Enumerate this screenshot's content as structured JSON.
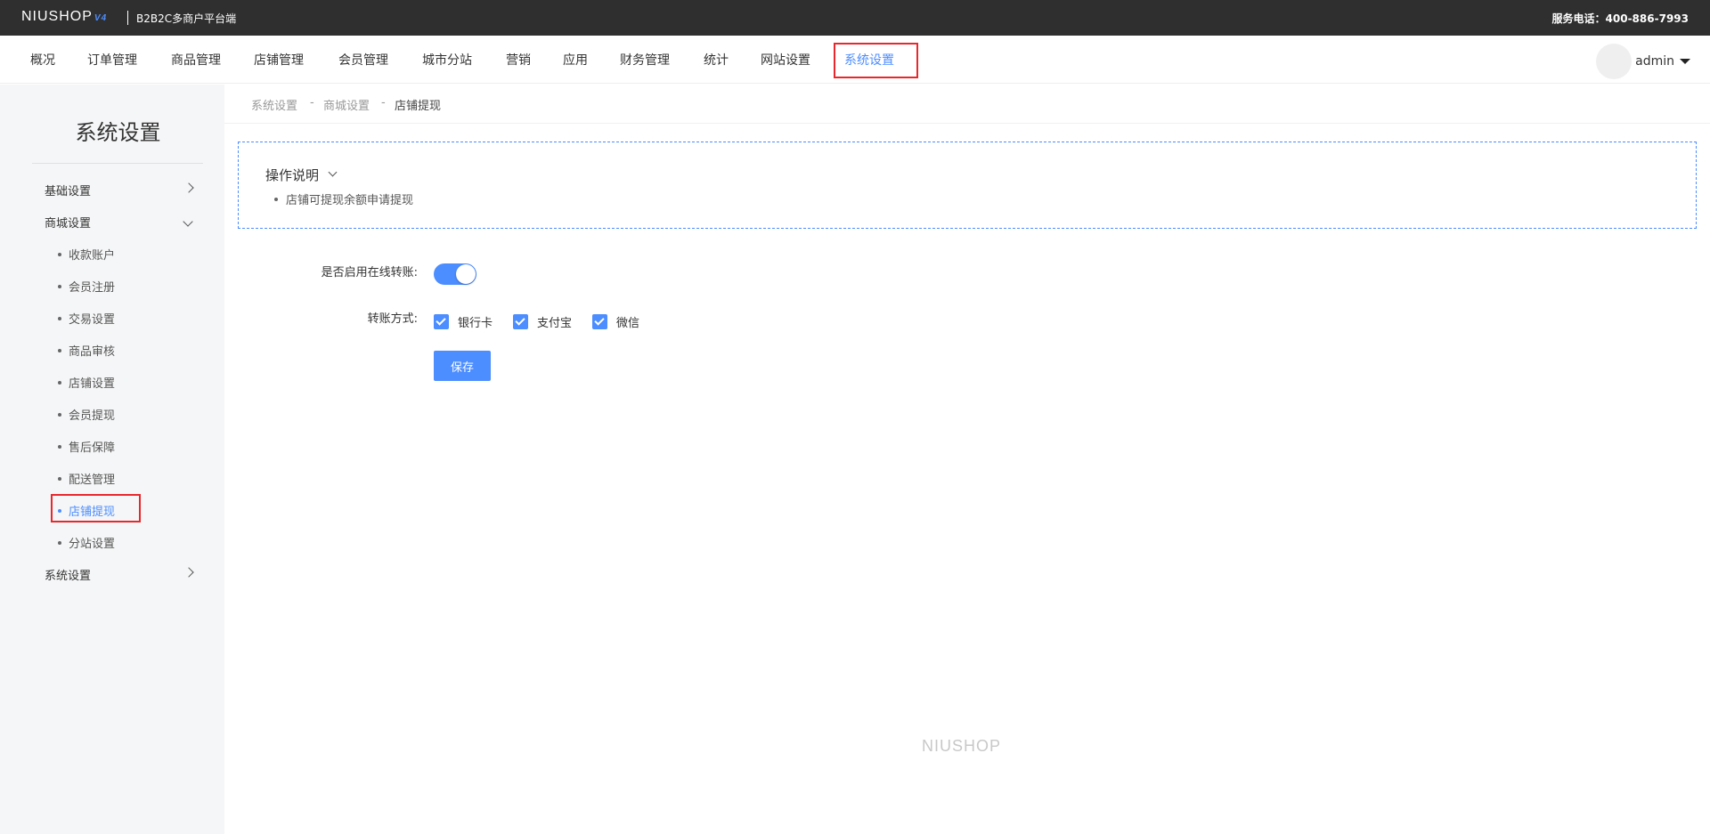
{
  "topbar": {
    "logo": "NIUSHOP",
    "logo_version": "V4",
    "platform": "B2B2C多商户平台端",
    "service_label": "服务电话：400-886-7993"
  },
  "nav": {
    "items": [
      "概况",
      "订单管理",
      "商品管理",
      "店铺管理",
      "会员管理",
      "城市分站",
      "营销",
      "应用",
      "财务管理",
      "统计",
      "网站设置",
      "系统设置"
    ],
    "active": "系统设置",
    "user": "admin"
  },
  "sidebar": {
    "title": "系统设置",
    "groups": [
      {
        "label": "基础设置"
      },
      {
        "label": "商城设置"
      },
      {
        "label": "系统设置"
      }
    ],
    "sub_items": [
      "收款账户",
      "会员注册",
      "交易设置",
      "商品审核",
      "店铺设置",
      "会员提现",
      "售后保障",
      "配送管理",
      "店铺提现",
      "分站设置"
    ],
    "active": "店铺提现"
  },
  "breadcrumb": {
    "items": [
      "系统设置",
      "商城设置",
      "店铺提现"
    ],
    "sep": "-"
  },
  "tip": {
    "title": "操作说明",
    "items": [
      "店铺可提现余额申请提现"
    ]
  },
  "form": {
    "online_transfer_label": "是否启用在线转账:",
    "online_transfer_enabled": true,
    "transfer_method_label": "转账方式:",
    "methods": [
      {
        "label": "银行卡",
        "checked": true
      },
      {
        "label": "支付宝",
        "checked": true
      },
      {
        "label": "微信",
        "checked": true
      }
    ],
    "save_label": "保存"
  },
  "footer": {
    "logo": "NIUSHOP"
  },
  "colors": {
    "accent": "#4c8dff",
    "highlight": "#e8282c",
    "topbar": "#2f2f2f"
  }
}
